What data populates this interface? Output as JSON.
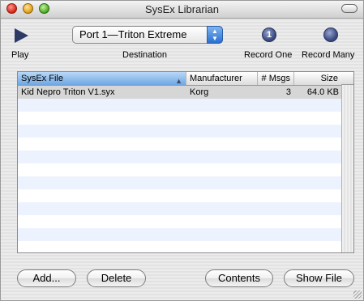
{
  "window": {
    "title": "SysEx Librarian"
  },
  "toolbar": {
    "play_label": "Play",
    "destination_label": "Destination",
    "destination_value": "Port 1—Triton Extreme",
    "record_one_label": "Record One",
    "record_one_badge": "1",
    "record_many_label": "Record Many"
  },
  "table": {
    "columns": [
      "SysEx File",
      "Manufacturer",
      "# Msgs",
      "Size"
    ],
    "sorted_column": "SysEx File",
    "rows": [
      {
        "file": "Kid Nepro Triton V1.syx",
        "manufacturer": "Korg",
        "msgs": "3",
        "size": "64.0 KB"
      }
    ]
  },
  "buttons": {
    "add": "Add...",
    "delete": "Delete",
    "contents": "Contents",
    "show_file": "Show File"
  },
  "colors": {
    "accent": "#2a6fd0",
    "record_icon": "#3f4f86",
    "alt_row": "#edf3fe",
    "selected_row": "#d6d6d6"
  },
  "icons": [
    "play-icon",
    "record-one-icon",
    "record-many-icon",
    "popup-arrows-icon",
    "sort-ascending-icon"
  ]
}
